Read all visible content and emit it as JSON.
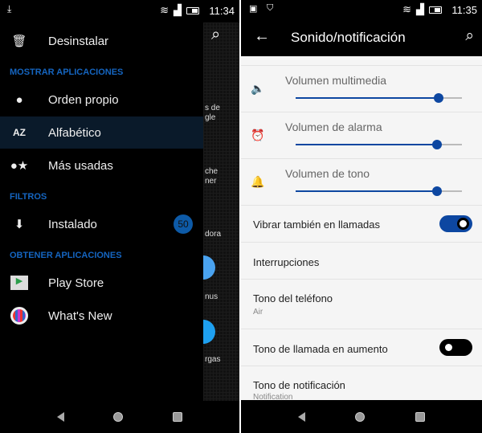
{
  "left": {
    "status": {
      "time": "11:34"
    },
    "drawer": {
      "uninstall": "Desinstalar",
      "section_show": "MOSTRAR APLICACIONES",
      "own_order": "Orden propio",
      "alphabetic": "Alfabético",
      "most_used": "Más usadas",
      "section_filters": "FILTROS",
      "installed": "Instalado",
      "installed_count": "50",
      "section_get": "OBTENER APLICACIONES",
      "play_store": "Play Store",
      "whats_new": "What's New"
    },
    "background_labels": [
      "s de",
      "gle",
      "che",
      "ner",
      "dora",
      "nus",
      "rgas"
    ]
  },
  "right": {
    "status": {
      "time": "11:35"
    },
    "toolbar": {
      "title": "Sonido/notificación"
    },
    "volumes": [
      {
        "label": "Volumen multimedia",
        "icon": "speaker-icon",
        "level": 0.86
      },
      {
        "label": "Volumen de alarma",
        "icon": "alarm-icon",
        "level": 0.85
      },
      {
        "label": "Volumen de tono",
        "icon": "bell-icon",
        "level": 0.85
      }
    ],
    "vibrate": {
      "label": "Vibrar también en llamadas",
      "on": true
    },
    "interruptions": "Interrupciones",
    "ringtone": {
      "label": "Tono del teléfono",
      "value": "Air"
    },
    "ascending": {
      "label": "Tono de llamada en aumento",
      "on": false
    },
    "notification": {
      "label": "Tono de notificación",
      "value": "Notification"
    }
  },
  "colors": {
    "accent": "#0d47a1",
    "header": "#1565c0"
  }
}
